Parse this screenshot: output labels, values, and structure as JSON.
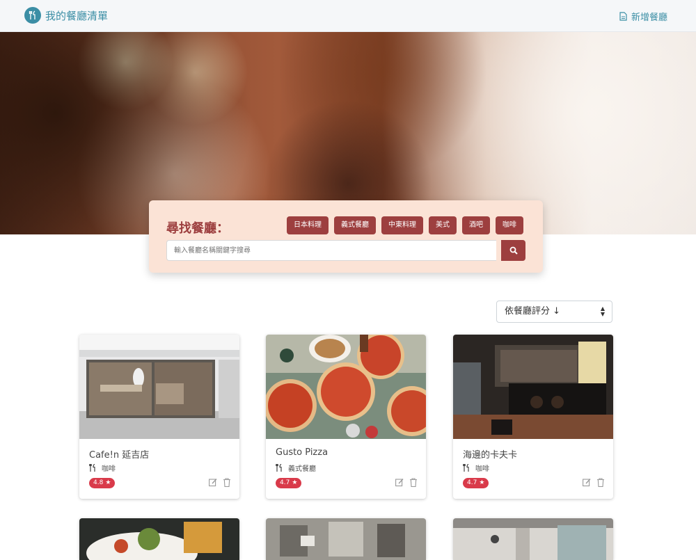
{
  "navbar": {
    "brand": "我的餐廳清單",
    "add_label": "新增餐廳"
  },
  "search": {
    "title": "尋找餐廳：",
    "tags": [
      "日本料理",
      "義式餐廳",
      "中東料理",
      "美式",
      "酒吧",
      "咖啡"
    ],
    "placeholder": "輸入餐廳名稱關鍵字搜尋"
  },
  "sort": {
    "selected": "依餐廳評分 ↓"
  },
  "restaurants": [
    {
      "name": "Cafe!n 延吉店",
      "category": "咖啡",
      "rating": "4.8"
    },
    {
      "name": "Gusto Pizza",
      "category": "義式餐廳",
      "rating": "4.7"
    },
    {
      "name": "海邊的卡夫卡",
      "category": "咖啡",
      "rating": "4.7"
    }
  ],
  "colors": {
    "brand": "#3b8ea5",
    "accent": "#9d3f3f",
    "rating": "#d93a4a",
    "search_bg": "#fbe3d6"
  },
  "icons": {
    "brand": "utensils-icon",
    "add": "file-icon",
    "search": "search-icon",
    "category": "utensils-icon",
    "star": "star-icon",
    "edit": "edit-icon",
    "delete": "trash-icon"
  }
}
